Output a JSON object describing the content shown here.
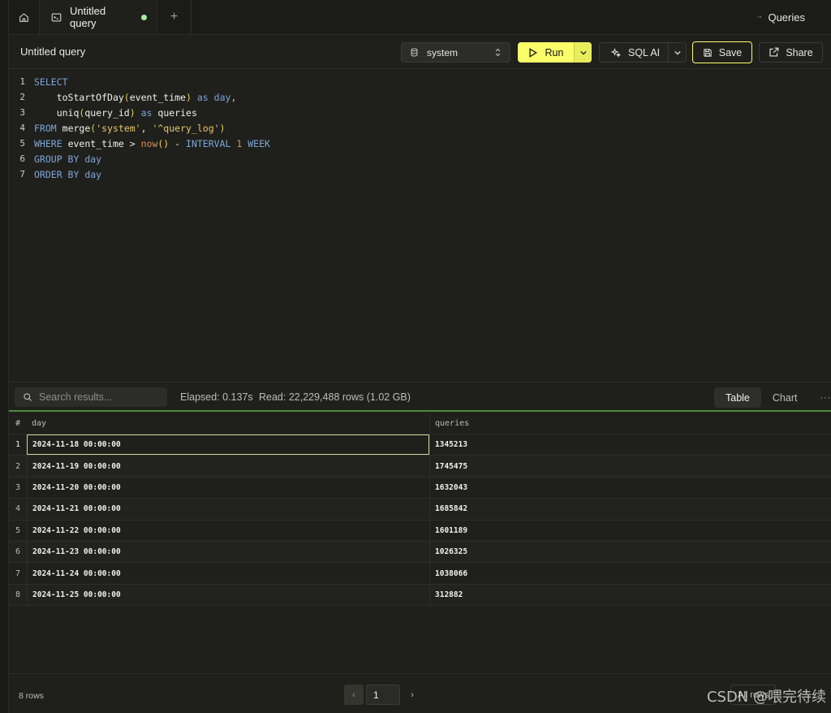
{
  "tabs": {
    "active_label": "Untitled query",
    "plus": "+",
    "queries_label": "Queries",
    "queries_dots": "··"
  },
  "toolbar": {
    "query_title": "Untitled query",
    "database": "system",
    "run_label": "Run",
    "sql_ai_label": "SQL AI",
    "save_label": "Save",
    "share_label": "Share"
  },
  "editor": {
    "lines": [
      {
        "n": "1"
      },
      {
        "n": "2"
      },
      {
        "n": "3"
      },
      {
        "n": "4"
      },
      {
        "n": "5"
      },
      {
        "n": "6"
      },
      {
        "n": "7"
      }
    ],
    "tokens": {
      "select": "SELECT",
      "toStartOfDay": "toStartOfDay",
      "event_time": "event_time",
      "as": "as",
      "day": "day",
      "uniq": "uniq",
      "query_id": "query_id",
      "queries": "queries",
      "from": "FROM",
      "merge": "merge",
      "system_str": "'system'",
      "query_log_str": "'^query_log'",
      "where": "WHERE",
      "now": "now",
      "interval": "INTERVAL",
      "one": "1",
      "week": "WEEK",
      "group_by": "GROUP BY",
      "order_by": "ORDER BY"
    }
  },
  "results": {
    "search_placeholder": "Search results...",
    "elapsed": "Elapsed: 0.137s",
    "read": "Read: 22,229,488 rows (1.02 GB)",
    "view_table": "Table",
    "view_chart": "Chart",
    "more": "···",
    "columns": [
      "#",
      "day",
      "queries"
    ],
    "rows": [
      {
        "n": "1",
        "day": "2024-11-18 00:00:00",
        "queries": "1345213"
      },
      {
        "n": "2",
        "day": "2024-11-19 00:00:00",
        "queries": "1745475"
      },
      {
        "n": "3",
        "day": "2024-11-20 00:00:00",
        "queries": "1632043"
      },
      {
        "n": "4",
        "day": "2024-11-21 00:00:00",
        "queries": "1685842"
      },
      {
        "n": "5",
        "day": "2024-11-22 00:00:00",
        "queries": "1601189"
      },
      {
        "n": "6",
        "day": "2024-11-23 00:00:00",
        "queries": "1026325"
      },
      {
        "n": "7",
        "day": "2024-11-24 00:00:00",
        "queries": "1038066"
      },
      {
        "n": "8",
        "day": "2024-11-25 00:00:00",
        "queries": "312882"
      }
    ]
  },
  "footer": {
    "rows_count": "8 rows",
    "page": "1",
    "prev": "‹",
    "next": "›",
    "per_page": "All rows",
    "watermark": "CSDN @喂完待续"
  },
  "colors": {
    "accent": "#faff69",
    "background": "#1f1f1c",
    "status_green": "#a3f0a0"
  }
}
